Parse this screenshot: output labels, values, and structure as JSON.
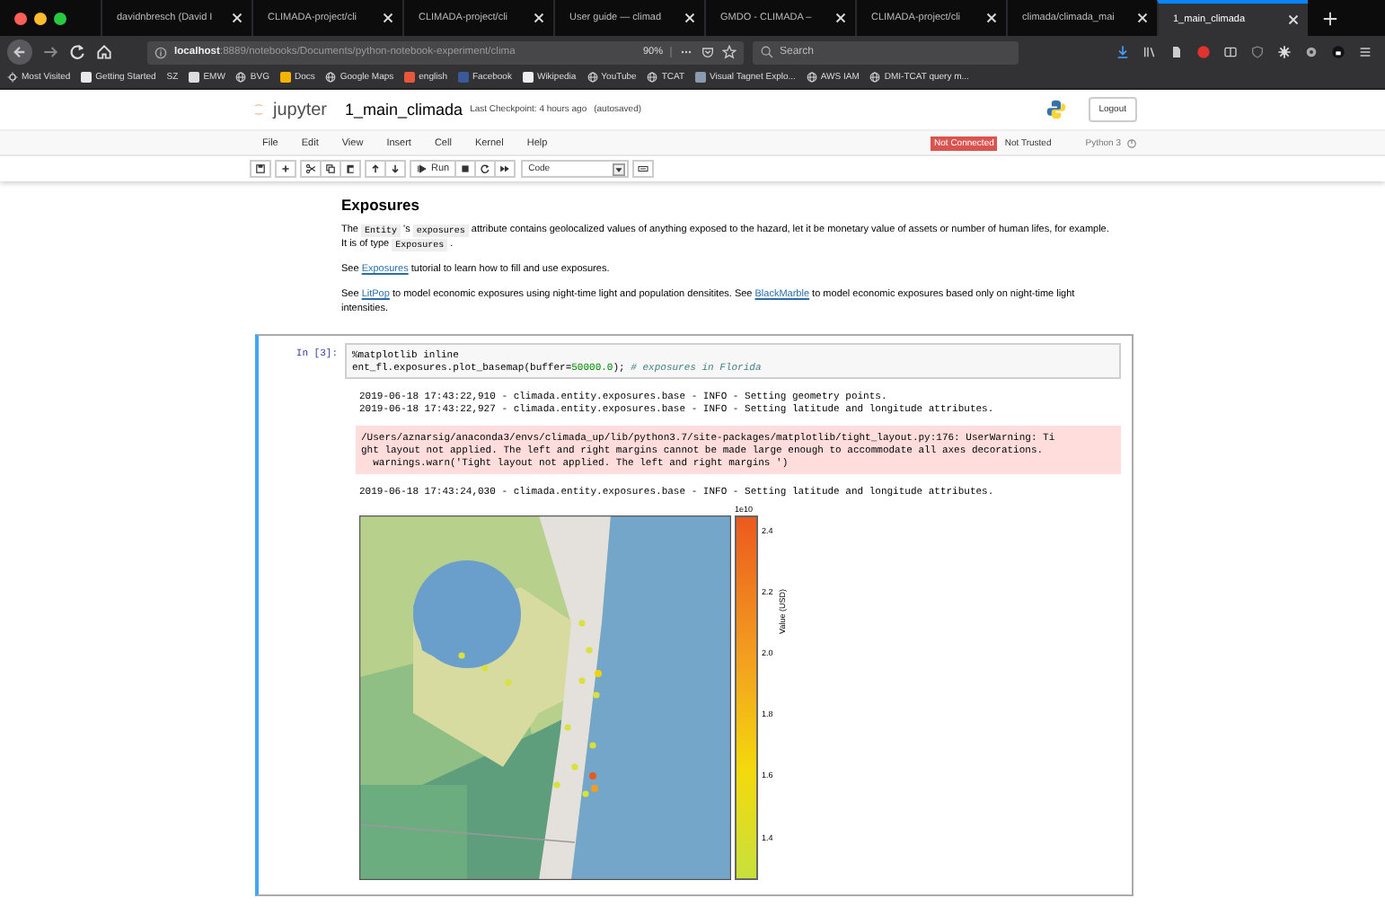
{
  "browser": {
    "tabs": [
      {
        "label": "davidnbresch (David I",
        "selected": false
      },
      {
        "label": "CLIMADA-project/cli",
        "selected": false
      },
      {
        "label": "CLIMADA-project/cli",
        "selected": false
      },
      {
        "label": "User guide — climad",
        "selected": false
      },
      {
        "label": "GMDO - CLIMADA – ",
        "selected": false
      },
      {
        "label": "CLIMADA-project/cli",
        "selected": false
      },
      {
        "label": "climada/climada_mai",
        "selected": false
      },
      {
        "label": "1_main_climada",
        "selected": true
      }
    ],
    "url": "**localhost**:8889/notebooks/Documents/python-notebook-experiment/clima",
    "zoom": "90%",
    "search": {
      "placeholder": "Search"
    },
    "bookmarks": [
      {
        "label": "Most Visited",
        "kind": "gear"
      },
      {
        "label": "Getting Started",
        "kind": "favicon",
        "color": "#e8e8e8"
      },
      {
        "label": "SZ",
        "kind": "text"
      },
      {
        "label": "EMW",
        "kind": "favicon",
        "color": "#dddddd"
      },
      {
        "label": "BVG",
        "kind": "globe"
      },
      {
        "label": "Docs",
        "kind": "favicon",
        "color": "#f4b400"
      },
      {
        "label": "Google Maps",
        "kind": "globe"
      },
      {
        "label": "english",
        "kind": "favicon",
        "color": "#e8573c"
      },
      {
        "label": "Facebook",
        "kind": "favicon",
        "color": "#3b5998"
      },
      {
        "label": "Wikipedia",
        "kind": "favicon",
        "color": "#eeeeee"
      },
      {
        "label": "YouTube",
        "kind": "globe"
      },
      {
        "label": "TCAT",
        "kind": "globe"
      },
      {
        "label": "Visual Tagnet Explo...",
        "kind": "favicon",
        "color": "#8a9bb0"
      },
      {
        "label": "AWS IAM",
        "kind": "globe"
      },
      {
        "label": "DMI-TCAT query m...",
        "kind": "globe"
      }
    ]
  },
  "jupyter": {
    "logo": "jupyter",
    "notebook_title": "1_main_climada",
    "checkpoint": "Last Checkpoint: 4 hours ago",
    "autosave": "(autosaved)",
    "logout": "Logout",
    "menu": [
      "File",
      "Edit",
      "View",
      "Insert",
      "Cell",
      "Kernel",
      "Help"
    ],
    "status": {
      "connection": "Not Connected",
      "trust": "Not Trusted",
      "kernel": "Python 3"
    },
    "toolbar": {
      "run": "Run",
      "cell_type": "Code"
    }
  },
  "markdown_cell": {
    "heading": "Exposures",
    "paragraphs": [
      [
        {
          "kind": "text",
          "text": "The "
        },
        {
          "kind": "code",
          "text": "Entity"
        },
        {
          "kind": "text",
          "text": " 's "
        },
        {
          "kind": "code",
          "text": "exposures"
        },
        {
          "kind": "text",
          "text": " attribute contains geolocalized values of anything exposed to the hazard, let it be monetary value of assets or number of human lifes, for example. It is of type "
        },
        {
          "kind": "code",
          "text": "Exposures"
        },
        {
          "kind": "text",
          "text": " ."
        }
      ],
      [
        {
          "kind": "text",
          "text": "See "
        },
        {
          "kind": "link",
          "text": "Exposures"
        },
        {
          "kind": "text",
          "text": " tutorial to learn how to fill and use exposures."
        }
      ],
      [
        {
          "kind": "text",
          "text": "See "
        },
        {
          "kind": "link",
          "text": "LitPop"
        },
        {
          "kind": "text",
          "text": " to model economic exposures using night-time light and population densitites. See "
        },
        {
          "kind": "link",
          "text": "BlackMarble"
        },
        {
          "kind": "text",
          "text": " to model economic exposures based only on night-time light intensities."
        }
      ]
    ]
  },
  "code_cell": {
    "prompt": "In [3]:",
    "selected": true,
    "input": [
      [
        {
          "kind": "magic",
          "text": "%matplotlib inline"
        }
      ],
      [
        {
          "kind": "plain",
          "text": "ent_fl.exposures.plot_basemap(buffer="
        },
        {
          "kind": "number",
          "text": "50000.0"
        },
        {
          "kind": "plain",
          "text": "); "
        },
        {
          "kind": "comment",
          "text": "# exposures in Florida"
        }
      ]
    ],
    "outputs": [
      {
        "kind": "log",
        "lines": [
          "2019-06-18 17:43:22,910 - climada.entity.exposures.base - INFO - Setting geometry points.",
          "2019-06-18 17:43:22,927 - climada.entity.exposures.base - INFO - Setting latitude and longitude attributes."
        ]
      },
      {
        "kind": "stderr",
        "lines": [
          "/Users/aznarsig/anaconda3/envs/climada_up/lib/python3.7/site-packages/matplotlib/tight_layout.py:176: UserWarning: Ti",
          "ght layout not applied. The left and right margins cannot be made large enough to accommodate all axes decorations.",
          "  warnings.warn('Tight layout not applied. The left and right margins ')"
        ]
      },
      {
        "kind": "log",
        "lines": [
          "2019-06-18 17:43:24,030 - climada.entity.exposures.base - INFO - Setting latitude and longitude attributes."
        ]
      },
      {
        "kind": "figure",
        "colorbar": {
          "exponent": "1e10",
          "label": "Value (USD)",
          "ticks": [
            "2.4",
            "2.2",
            "2.0",
            "1.8",
            "1.6",
            "1.4"
          ]
        }
      }
    ]
  }
}
